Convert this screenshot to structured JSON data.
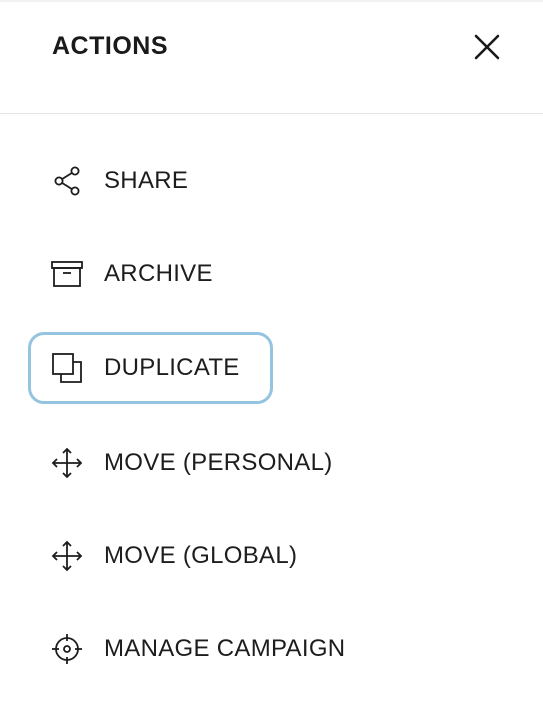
{
  "header": {
    "title": "ACTIONS",
    "close_icon": "close-icon"
  },
  "menu": {
    "items": [
      {
        "label": "SHARE",
        "icon": "share-icon"
      },
      {
        "label": "ARCHIVE",
        "icon": "archive-icon"
      },
      {
        "label": "DUPLICATE",
        "icon": "duplicate-icon",
        "focused": true
      },
      {
        "label": "MOVE (PERSONAL)",
        "icon": "move-icon"
      },
      {
        "label": "MOVE (GLOBAL)",
        "icon": "move-icon"
      },
      {
        "label": "MANAGE CAMPAIGN",
        "icon": "target-icon"
      }
    ]
  },
  "colors": {
    "focus_ring": "#94c4df",
    "text": "#1d1d1d",
    "divider": "#e4e4e4"
  }
}
